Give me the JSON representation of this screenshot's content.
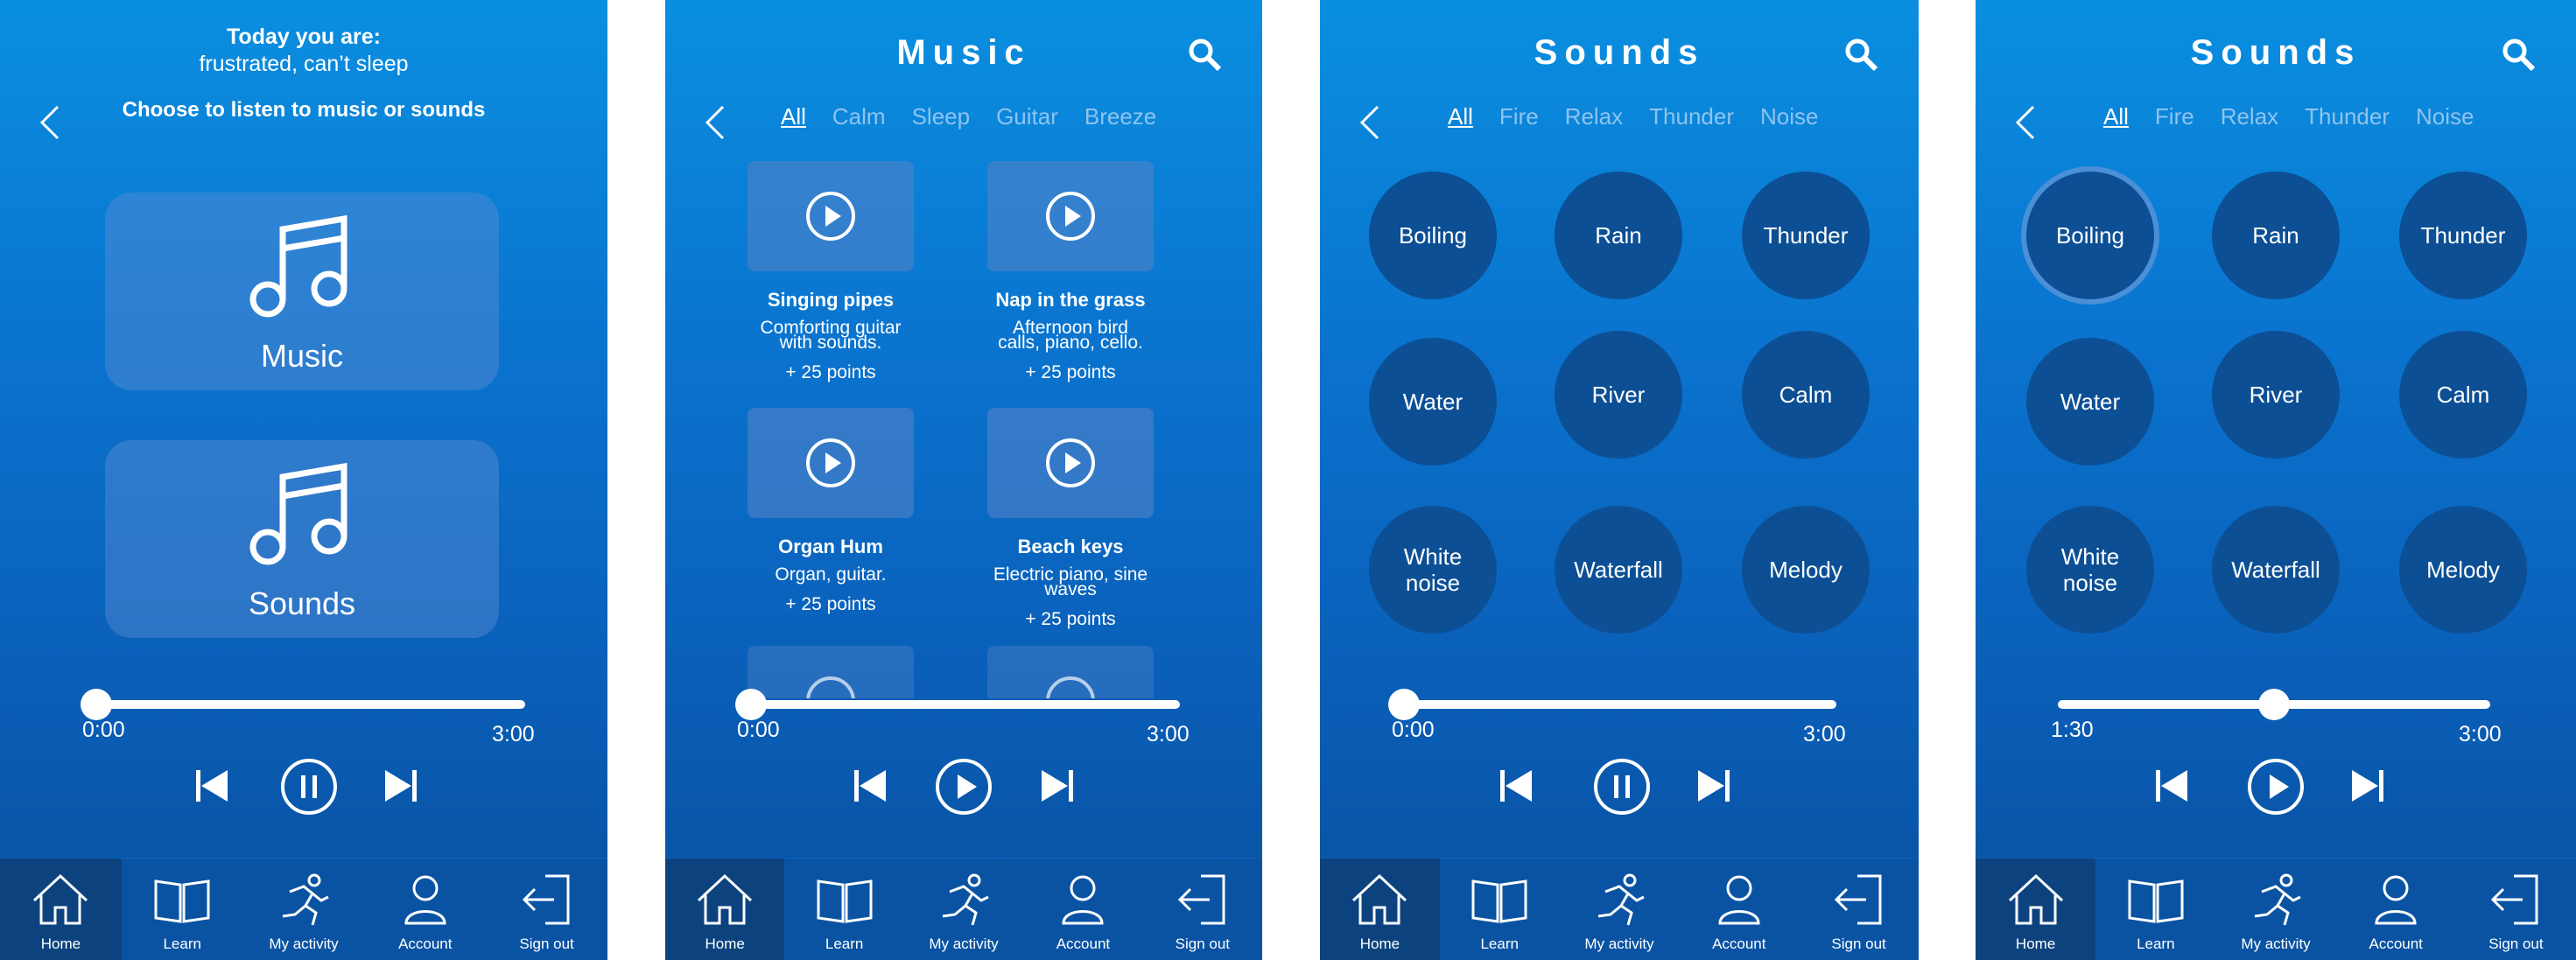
{
  "nav": {
    "home": "Home",
    "learn": "Learn",
    "activity": "My activity",
    "account": "Account",
    "signout": "Sign out"
  },
  "screen1": {
    "heading_line1": "Today you are:",
    "heading_line2": "frustrated, can’t sleep",
    "subtitle": "Choose to listen to music or sounds",
    "music_label": "Music",
    "sounds_label": "Sounds",
    "time_start": "0:00",
    "time_end": "3:00",
    "progress": 0
  },
  "screen2": {
    "title": "Music",
    "filters": [
      "All",
      "Calm",
      "Sleep",
      "Guitar",
      "Breeze"
    ],
    "cards": [
      {
        "name": "Singing pipes",
        "desc1": "Comforting guitar",
        "desc2": "with sounds.",
        "points": "+ 25 points"
      },
      {
        "name": "Nap in the grass",
        "desc1": "Afternoon bird",
        "desc2": "calls, piano, cello.",
        "points": "+ 25 points"
      },
      {
        "name": "Organ Hum",
        "desc1": "Organ, guitar.",
        "desc2": "",
        "points": "+ 25 points"
      },
      {
        "name": "Beach keys",
        "desc1": "Electric piano, sine",
        "desc2": "waves",
        "points": "+ 25 points"
      }
    ],
    "time_start": "0:00",
    "time_end": "3:00",
    "progress": 0
  },
  "screen3": {
    "title": "Sounds",
    "filters": [
      "All",
      "Fire",
      "Relax",
      "Thunder",
      "Noise"
    ],
    "sounds": [
      "Boiling",
      "Rain",
      "Thunder",
      "Water",
      "River",
      "Calm",
      "White noise",
      "Waterfall",
      "Melody"
    ],
    "time_start": "0:00",
    "time_end": "3:00",
    "progress": 0
  },
  "screen4": {
    "title": "Sounds",
    "filters": [
      "All",
      "Fire",
      "Relax",
      "Thunder",
      "Noise"
    ],
    "sounds": [
      "Boiling",
      "Rain",
      "Thunder",
      "Water",
      "River",
      "Calm",
      "White noise",
      "Waterfall",
      "Melody"
    ],
    "selected": "Boiling",
    "time_start": "1:30",
    "time_end": "3:00",
    "progress": 0.5
  }
}
